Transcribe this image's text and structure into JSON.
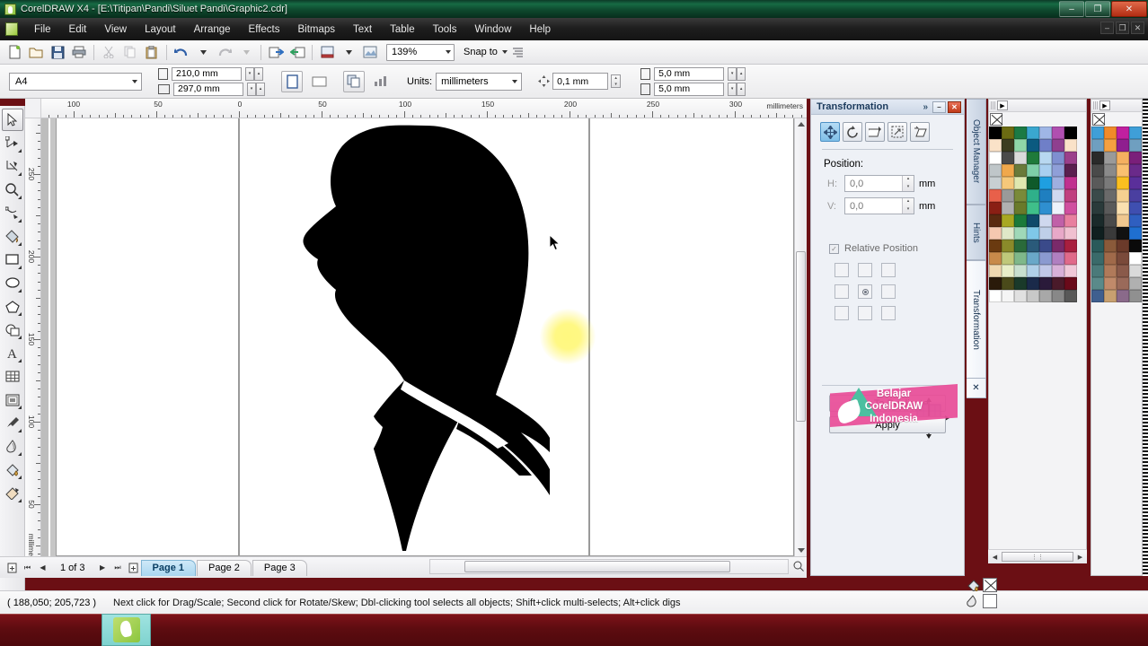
{
  "window": {
    "title": "CorelDRAW X4 - [E:\\Titipan\\Pandi\\Siluet Pandi\\Graphic2.cdr]",
    "minimize_label": "–",
    "restore_label": "❐",
    "close_label": "✕",
    "mdi_minimize": "–",
    "mdi_restore": "❐",
    "mdi_close": "✕"
  },
  "menu": {
    "items": [
      {
        "label": "File"
      },
      {
        "label": "Edit"
      },
      {
        "label": "View"
      },
      {
        "label": "Layout"
      },
      {
        "label": "Arrange"
      },
      {
        "label": "Effects"
      },
      {
        "label": "Bitmaps"
      },
      {
        "label": "Text"
      },
      {
        "label": "Table"
      },
      {
        "label": "Tools"
      },
      {
        "label": "Window"
      },
      {
        "label": "Help"
      }
    ]
  },
  "toolbar": {
    "icons": [
      {
        "name": "new-document-icon"
      },
      {
        "name": "open-document-icon"
      },
      {
        "name": "save-icon"
      },
      {
        "name": "print-icon"
      },
      {
        "name": "cut-icon"
      },
      {
        "name": "copy-icon"
      },
      {
        "name": "paste-icon"
      },
      {
        "name": "undo-icon"
      },
      {
        "name": "redo-icon"
      },
      {
        "name": "import-icon"
      },
      {
        "name": "export-icon"
      },
      {
        "name": "launch-icon"
      },
      {
        "name": "application-icon"
      }
    ],
    "zoom_level": "139%",
    "snap_to_label": "Snap to",
    "options_icon": "options-icon"
  },
  "propertybar": {
    "paper_type": "A4",
    "paper_width": "210,0 mm",
    "paper_height": "297,0 mm",
    "orientation_portrait_icon": "portrait-icon",
    "orientation_landscape_icon": "landscape-icon",
    "page_all_icon": "apply-all-pages-icon",
    "page_current_icon": "apply-current-page-icon",
    "units_label": "Units:",
    "units_value": "millimeters",
    "nudge_value": "0,1 mm",
    "duplicate_x": "5,0 mm",
    "duplicate_y": "5,0 mm"
  },
  "toolbox": {
    "tools": [
      {
        "name": "pick-tool",
        "active": true
      },
      {
        "name": "shape-tool",
        "active": false
      },
      {
        "name": "crop-tool",
        "active": false
      },
      {
        "name": "zoom-tool",
        "active": false
      },
      {
        "name": "freehand-tool",
        "active": false
      },
      {
        "name": "smart-fill-tool",
        "active": false
      },
      {
        "name": "rectangle-tool",
        "active": false
      },
      {
        "name": "ellipse-tool",
        "active": false
      },
      {
        "name": "polygon-tool",
        "active": false
      },
      {
        "name": "basic-shapes-tool",
        "active": false
      },
      {
        "name": "text-tool",
        "active": false
      },
      {
        "name": "table-tool",
        "active": false
      },
      {
        "name": "interactive-blend-tool",
        "active": false
      },
      {
        "name": "eyedropper-tool",
        "active": false
      },
      {
        "name": "outline-tool",
        "active": false
      },
      {
        "name": "fill-tool",
        "active": false
      },
      {
        "name": "interactive-fill-tool",
        "active": false
      }
    ]
  },
  "rulers": {
    "units": "millimeters",
    "horizontal_labels": [
      "100",
      "50",
      "0",
      "50",
      "100",
      "150",
      "200",
      "250",
      "300"
    ],
    "vertical_labels": [
      "250",
      "200",
      "150",
      "100",
      "50"
    ]
  },
  "canvas": {
    "artwork_name": "man-profile-silhouette",
    "cursor_name": "mouse-cursor"
  },
  "pagebar": {
    "new_page_icon": "new-page-icon",
    "first_icon": "⏮",
    "prev_icon": "◀",
    "next_icon": "▶",
    "last_icon": "⏭",
    "add_page_icon": "add-page-icon",
    "counter": "1 of 3",
    "tabs": [
      {
        "label": "Page 1",
        "active": true
      },
      {
        "label": "Page 2",
        "active": false
      },
      {
        "label": "Page 3",
        "active": false
      }
    ]
  },
  "docker": {
    "title": "Transformation",
    "chevron": "»",
    "minimize_label": "–",
    "close_label": "✕",
    "modes": [
      {
        "name": "position-mode",
        "active": true
      },
      {
        "name": "rotate-mode",
        "active": false
      },
      {
        "name": "scale-mirror-mode",
        "active": false
      },
      {
        "name": "size-mode",
        "active": false
      },
      {
        "name": "skew-mode",
        "active": false
      }
    ],
    "position_label": "Position:",
    "h_label": "H:",
    "h_value": "0,0",
    "h_unit": "mm",
    "v_label": "V:",
    "v_value": "0,0",
    "v_unit": "mm",
    "relative_position_label": "Relative Position",
    "relative_position_checked": "✓",
    "apply_to_duplicate_label": "Apply To Duplicate",
    "apply_label": "Apply",
    "tabs": [
      {
        "label": "Object Manager",
        "active": false
      },
      {
        "label": "Hints",
        "active": false
      },
      {
        "label": "Transformation",
        "active": true
      }
    ],
    "tab_close": "✕"
  },
  "watermark": {
    "line1": "Belajar",
    "line2": "CorelDRAW",
    "line3": "Indonesia",
    "color": "#e84d98"
  },
  "palette": {
    "menu_icon": "▶",
    "none_swatch_name": "no-color-swatch",
    "nav_left": "◀",
    "nav_right": "▶",
    "nav_more": "⋮⋮",
    "columns": [
      {
        "rows": [
          [
            "#000000",
            "#6b6b12",
            "#1b7a44",
            "#3aa7cf",
            "#9fb6e6",
            "#b04fb0"
          ],
          [
            "#fae2c8",
            "#3c3c20",
            "#8fd6a8",
            "#0b5a80",
            "#6f7fc8",
            "#8f3f8f"
          ],
          [
            "#ffffff",
            "#4a4a4a",
            "#dadada",
            "#1f7a3a",
            "#b8d8f0",
            "#7f8fd0",
            "#9b3f8b"
          ],
          [
            "#bfc6c9",
            "#f0a84c",
            "#6a7a3a",
            "#7fcfa8",
            "#a8cff0",
            "#8f9fd8",
            "#5a1f4f"
          ],
          [
            "#c8cfd2",
            "#f5c87a",
            "#dfe8b0",
            "#0f5a2a",
            "#1f9fe0",
            "#9fafe0",
            "#c0308f"
          ],
          [
            "#e8604a",
            "#9a9a9a",
            "#7a8a3a",
            "#2fb08a",
            "#1f7fc0",
            "#cfd8f0",
            "#c03f7f"
          ],
          [
            "#8a1f14",
            "#b0b0b0",
            "#6a7a2a",
            "#3fbf8a",
            "#2f8fd0",
            "#eef2fb",
            "#d04f9f"
          ],
          [
            "#5a2a10",
            "#a8a822",
            "#1b7a3a",
            "#0f4a6a",
            "#cfd8ee",
            "#c060a8",
            "#e87f9f"
          ],
          [
            "#f5c8b0",
            "#dfe8c8",
            "#9fd8b8",
            "#7fc8e8",
            "#bfcfe8",
            "#e8a8c8",
            "#f0c0d0"
          ],
          [
            "#6a3a10",
            "#8a8a2a",
            "#2a6a3a",
            "#2a5a7a",
            "#3a4a8a",
            "#7a2a6a",
            "#a81f3f"
          ],
          [
            "#c88a4a",
            "#bfc87a",
            "#7fb88a",
            "#6aa8c8",
            "#8a9ad0",
            "#b07fc0",
            "#e06a8a"
          ],
          [
            "#f0d8b0",
            "#e8efc8",
            "#c8e0cf",
            "#b0d0e8",
            "#c0c8e8",
            "#d8b0d8",
            "#f0c8d8"
          ],
          [
            "#2a1a0a",
            "#4a4a1a",
            "#1a3a2a",
            "#1a2a4a",
            "#2a1a3a",
            "#4a1a2a",
            "#6a0a1a"
          ],
          [
            "#ffffff",
            "#f5f5f5",
            "#e0e0e0",
            "#c8c8c8",
            "#a8a8a8",
            "#888888",
            "#585858"
          ]
        ]
      },
      {
        "rows": [
          [
            "#3f9fd8",
            "#f08a2a",
            "#c020a0"
          ],
          [
            "#6f9fc0",
            "#f5a040",
            "#8f1f8f"
          ],
          [
            "#2a2a2a",
            "#9a9a9a",
            "#f5b060",
            "#7a1f7a"
          ],
          [
            "#4a4a4a",
            "#8a8a8a",
            "#fac070",
            "#6a2a8a"
          ],
          [
            "#5a5a5a",
            "#7a7a7a",
            "#fbbf1f",
            "#5a2f9a"
          ],
          [
            "#3a4a4a",
            "#6a6a6a",
            "#f5d090",
            "#4a3fa0"
          ],
          [
            "#2a3a3a",
            "#5a5a5a",
            "#fae0b0",
            "#3f4fb0"
          ],
          [
            "#1a2a2a",
            "#4a4a4a",
            "#f0c890",
            "#2f5fc0"
          ],
          [
            "#0f1f1f",
            "#3a3a3a",
            "#111111",
            "#1f6fd0"
          ],
          [
            "#2a5a5a",
            "#8a5a3a",
            "#6a3a2a",
            "#0a0a0a"
          ],
          [
            "#3a6a6a",
            "#a06a4a",
            "#7a4a3a",
            "#ffffff"
          ],
          [
            "#4a7a7a",
            "#b07a5a",
            "#8a5a4a",
            "#dadada"
          ],
          [
            "#5a8a8a",
            "#c08a6a",
            "#9a6a5a",
            "#b0b0b0"
          ],
          [
            "#3f5f8f",
            "#c8a070",
            "#8a6a8a",
            "#909090"
          ]
        ]
      }
    ]
  },
  "statusbar": {
    "coordinates": "( 188,050; 205,723 )",
    "hint": "Next click for Drag/Scale; Second click for Rotate/Skew; Dbl-clicking tool selects all objects; Shift+click multi-selects; Alt+click digs",
    "fill_icon": "fill-icon",
    "outline_icon": "outline-icon",
    "fill_value_name": "no-fill-swatch",
    "outline_value_name": "white-outline-swatch"
  },
  "taskbar": {
    "item_name": "coreldraw-taskbar-item"
  }
}
